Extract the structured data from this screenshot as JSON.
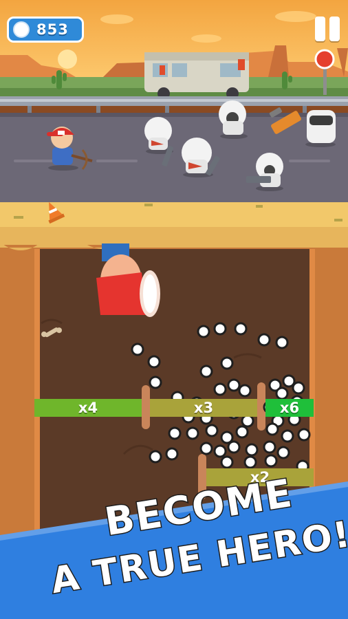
{
  "hud": {
    "coins": "853",
    "coin_icon": "coin-icon",
    "pause_icon": "pause-icon"
  },
  "multipliers": [
    {
      "label": "x4",
      "color": "#6fb62b"
    },
    {
      "label": "x3",
      "color": "#a9a33a"
    },
    {
      "label": "x6",
      "color": "#1fbf3a"
    },
    {
      "label": "x2",
      "color": "#a9a33a"
    }
  ],
  "banner": {
    "line1": "BECOME",
    "line2": "A TRUE HERO!",
    "color": "#2f7fe0"
  },
  "colors": {
    "sky_top": "#f6b347",
    "road": "#6e6a78",
    "dirt": "#5a3a26",
    "wall": "#c97a3a"
  }
}
